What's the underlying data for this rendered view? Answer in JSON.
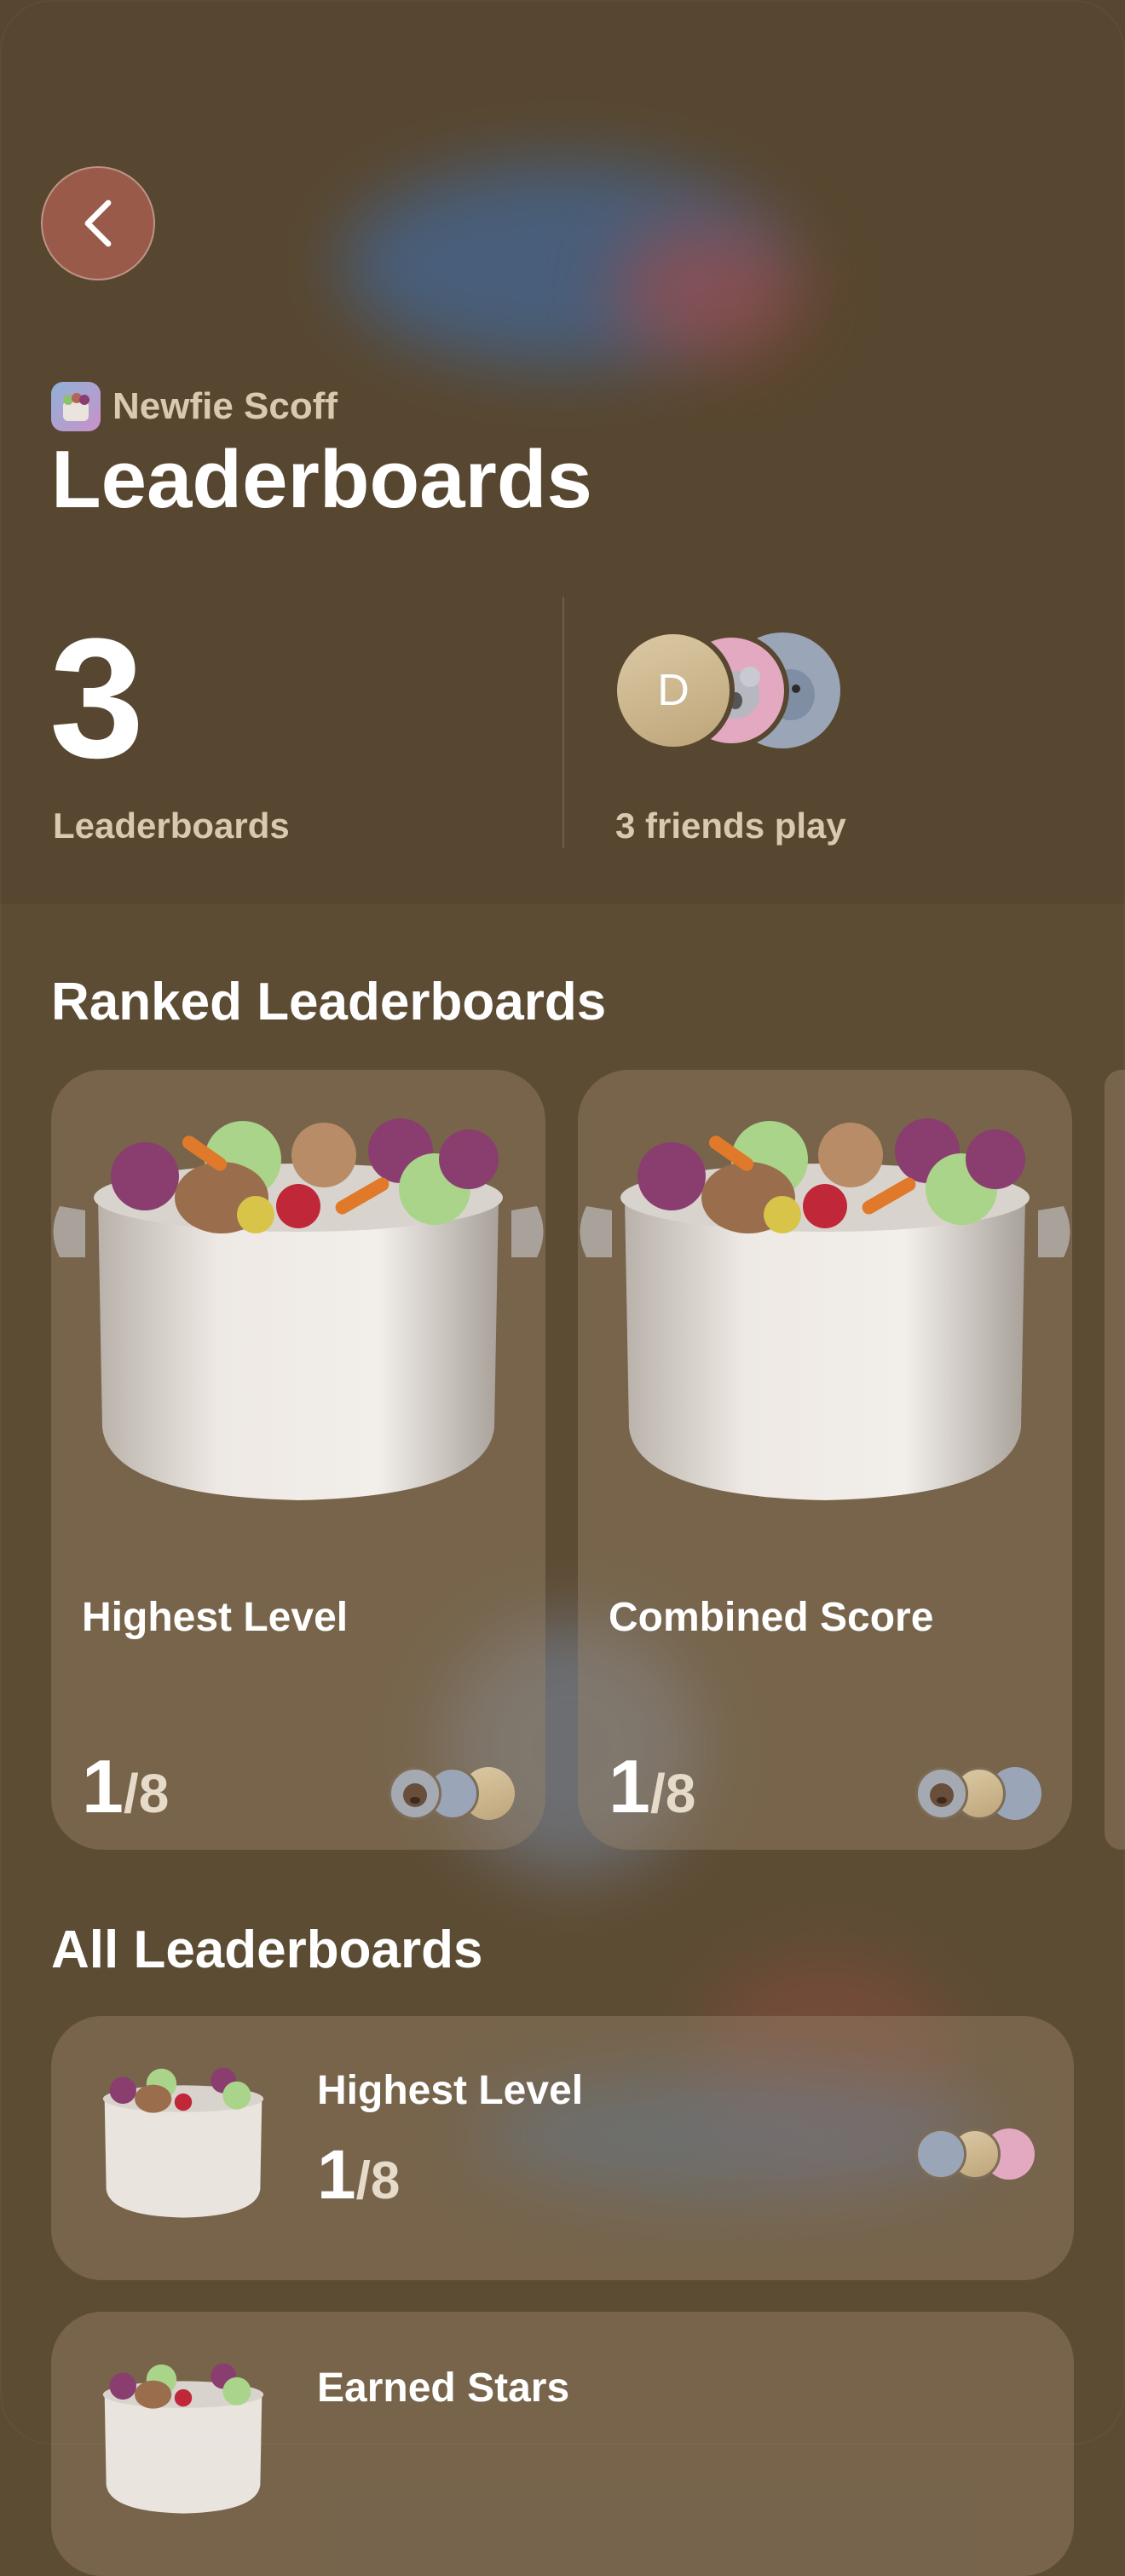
{
  "app": {
    "name": "Newfie Scoff",
    "icon": "stew-pot-icon"
  },
  "page": {
    "title": "Leaderboards"
  },
  "stats": {
    "count": "3",
    "count_label": "Leaderboards",
    "friends_label": "3 friends play",
    "friend_avatars": [
      {
        "initial": "D",
        "kind": "initial-avatar"
      },
      {
        "kind": "koala-memoji-avatar"
      },
      {
        "kind": "shark-memoji-avatar"
      }
    ]
  },
  "ranked_section": {
    "title": "Ranked Leaderboards"
  },
  "ranked_cards": [
    {
      "title": "Highest Level",
      "rank": "1",
      "total": "/8"
    },
    {
      "title": "Combined Score",
      "rank": "1",
      "total": "/8"
    }
  ],
  "all_section": {
    "title": "All Leaderboards"
  },
  "all_rows": [
    {
      "title": "Highest Level",
      "rank": "1",
      "total": "/8"
    },
    {
      "title": "Earned Stars"
    }
  ],
  "colors": {
    "background": "#5d4c34",
    "back_button": "#9a5a49",
    "secondary_text": "#d9c9b0"
  }
}
